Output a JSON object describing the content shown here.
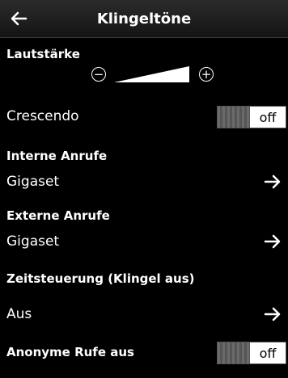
{
  "header": {
    "title": "Klingeltöne",
    "back_icon": "arrow-left-icon"
  },
  "volume": {
    "label": "Lautstärke",
    "minus_icon": "minus-circle-icon",
    "plus_icon": "plus-circle-icon",
    "minus_symbol": "−",
    "plus_symbol": "+",
    "level": 1.0
  },
  "crescendo": {
    "label": "Crescendo",
    "state": "off"
  },
  "internal_calls": {
    "heading": "Interne Anrufe",
    "value": "Gigaset",
    "arrow_icon": "arrow-right-icon"
  },
  "external_calls": {
    "heading": "Externe Anrufe",
    "value": "Gigaset",
    "arrow_icon": "arrow-right-icon"
  },
  "time_control": {
    "heading": "Zeitsteuerung (Klingel aus)",
    "value": "Aus",
    "arrow_icon": "arrow-right-icon"
  },
  "anonymous_calls": {
    "label": "Anonyme Rufe aus",
    "state": "off"
  },
  "colors": {
    "background": "#000000",
    "text": "#ffffff",
    "toggle_state_bg": "#ffffff"
  }
}
